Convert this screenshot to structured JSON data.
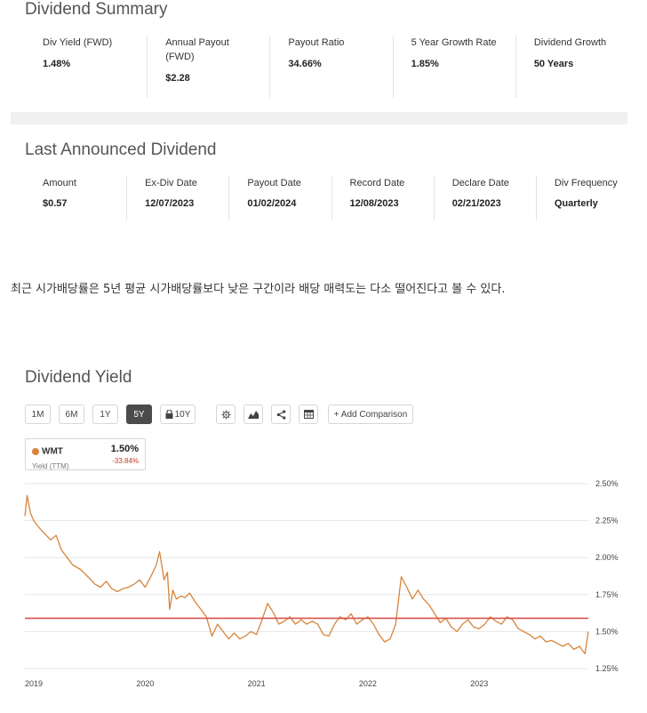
{
  "summary": {
    "title": "Dividend Summary",
    "items": [
      {
        "label": "Div Yield (FWD)",
        "value": "1.48%"
      },
      {
        "label": "Annual Payout (FWD)",
        "value": "$2.28"
      },
      {
        "label": "Payout Ratio",
        "value": "34.66%"
      },
      {
        "label": "5 Year Growth Rate",
        "value": "1.85%"
      },
      {
        "label": "Dividend Growth",
        "value": "50 Years"
      }
    ]
  },
  "announced": {
    "title": "Last Announced Dividend",
    "items": [
      {
        "label": "Amount",
        "value": "$0.57"
      },
      {
        "label": "Ex-Div Date",
        "value": "12/07/2023"
      },
      {
        "label": "Payout Date",
        "value": "01/02/2024"
      },
      {
        "label": "Record Date",
        "value": "12/08/2023"
      },
      {
        "label": "Declare Date",
        "value": "02/21/2023"
      },
      {
        "label": "Div Frequency",
        "value": "Quarterly"
      }
    ]
  },
  "note": "최근 시가배당률은 5년 평균 시가배당률보다 낮은 구간이라 배당 매력도는 다소 떨어진다고 볼 수 있다.",
  "chart_section": {
    "title": "Dividend Yield",
    "ranges": [
      "1M",
      "6M",
      "1Y",
      "5Y",
      "10Y"
    ],
    "active_range": "5Y",
    "add_comparison": "+ Add Comparison",
    "icons": [
      "gear-icon",
      "mountain-chart-icon",
      "share-icon",
      "table-icon"
    ],
    "legend": {
      "ticker": "WMT",
      "sub": "Yield (TTM)",
      "value": "1.50%",
      "change": "-33.84%"
    }
  },
  "chart_data": {
    "type": "line",
    "title": "Dividend Yield",
    "xlabel": "",
    "ylabel": "",
    "x_ticks": [
      "2019",
      "2020",
      "2021",
      "2022",
      "2023"
    ],
    "y_ticks": [
      "2.50%",
      "2.25%",
      "2.00%",
      "1.75%",
      "1.50%",
      "1.25%"
    ],
    "ylim": [
      1.25,
      2.5
    ],
    "xlim": [
      2018.92,
      2023.98
    ],
    "grid": "horizontal",
    "reference_line": {
      "value": 1.59,
      "color": "#d9534f"
    },
    "series": [
      {
        "name": "WMT",
        "color": "#d7843a",
        "x": [
          2018.92,
          2018.94,
          2018.97,
          2019.0,
          2019.05,
          2019.1,
          2019.15,
          2019.2,
          2019.25,
          2019.3,
          2019.35,
          2019.42,
          2019.5,
          2019.55,
          2019.6,
          2019.65,
          2019.7,
          2019.75,
          2019.8,
          2019.85,
          2019.9,
          2019.95,
          2020.0,
          2020.05,
          2020.1,
          2020.13,
          2020.17,
          2020.2,
          2020.22,
          2020.25,
          2020.28,
          2020.32,
          2020.36,
          2020.4,
          2020.45,
          2020.5,
          2020.55,
          2020.6,
          2020.65,
          2020.7,
          2020.75,
          2020.8,
          2020.85,
          2020.9,
          2020.95,
          2021.0,
          2021.05,
          2021.1,
          2021.15,
          2021.2,
          2021.25,
          2021.3,
          2021.35,
          2021.4,
          2021.45,
          2021.5,
          2021.55,
          2021.6,
          2021.65,
          2021.7,
          2021.75,
          2021.8,
          2021.85,
          2021.9,
          2021.95,
          2022.0,
          2022.05,
          2022.1,
          2022.15,
          2022.2,
          2022.25,
          2022.3,
          2022.35,
          2022.4,
          2022.45,
          2022.5,
          2022.55,
          2022.6,
          2022.65,
          2022.7,
          2022.75,
          2022.8,
          2022.85,
          2022.9,
          2022.95,
          2023.0,
          2023.05,
          2023.1,
          2023.15,
          2023.2,
          2023.25,
          2023.3,
          2023.35,
          2023.4,
          2023.45,
          2023.5,
          2023.55,
          2023.6,
          2023.65,
          2023.7,
          2023.75,
          2023.8,
          2023.85,
          2023.9,
          2023.95,
          2023.98
        ],
        "values": [
          2.28,
          2.42,
          2.3,
          2.25,
          2.2,
          2.16,
          2.12,
          2.15,
          2.05,
          2.0,
          1.95,
          1.92,
          1.86,
          1.82,
          1.8,
          1.84,
          1.79,
          1.77,
          1.79,
          1.8,
          1.82,
          1.85,
          1.8,
          1.87,
          1.95,
          2.04,
          1.85,
          1.9,
          1.65,
          1.78,
          1.72,
          1.74,
          1.73,
          1.76,
          1.7,
          1.65,
          1.6,
          1.47,
          1.55,
          1.5,
          1.45,
          1.49,
          1.45,
          1.47,
          1.5,
          1.48,
          1.58,
          1.69,
          1.63,
          1.55,
          1.57,
          1.6,
          1.55,
          1.58,
          1.55,
          1.57,
          1.55,
          1.48,
          1.47,
          1.55,
          1.6,
          1.58,
          1.62,
          1.55,
          1.58,
          1.6,
          1.55,
          1.48,
          1.43,
          1.45,
          1.55,
          1.87,
          1.8,
          1.72,
          1.78,
          1.72,
          1.68,
          1.62,
          1.56,
          1.59,
          1.53,
          1.5,
          1.55,
          1.58,
          1.53,
          1.52,
          1.55,
          1.6,
          1.57,
          1.55,
          1.6,
          1.58,
          1.52,
          1.5,
          1.48,
          1.45,
          1.47,
          1.43,
          1.44,
          1.42,
          1.4,
          1.42,
          1.38,
          1.4,
          1.35,
          1.5
        ]
      }
    ]
  }
}
